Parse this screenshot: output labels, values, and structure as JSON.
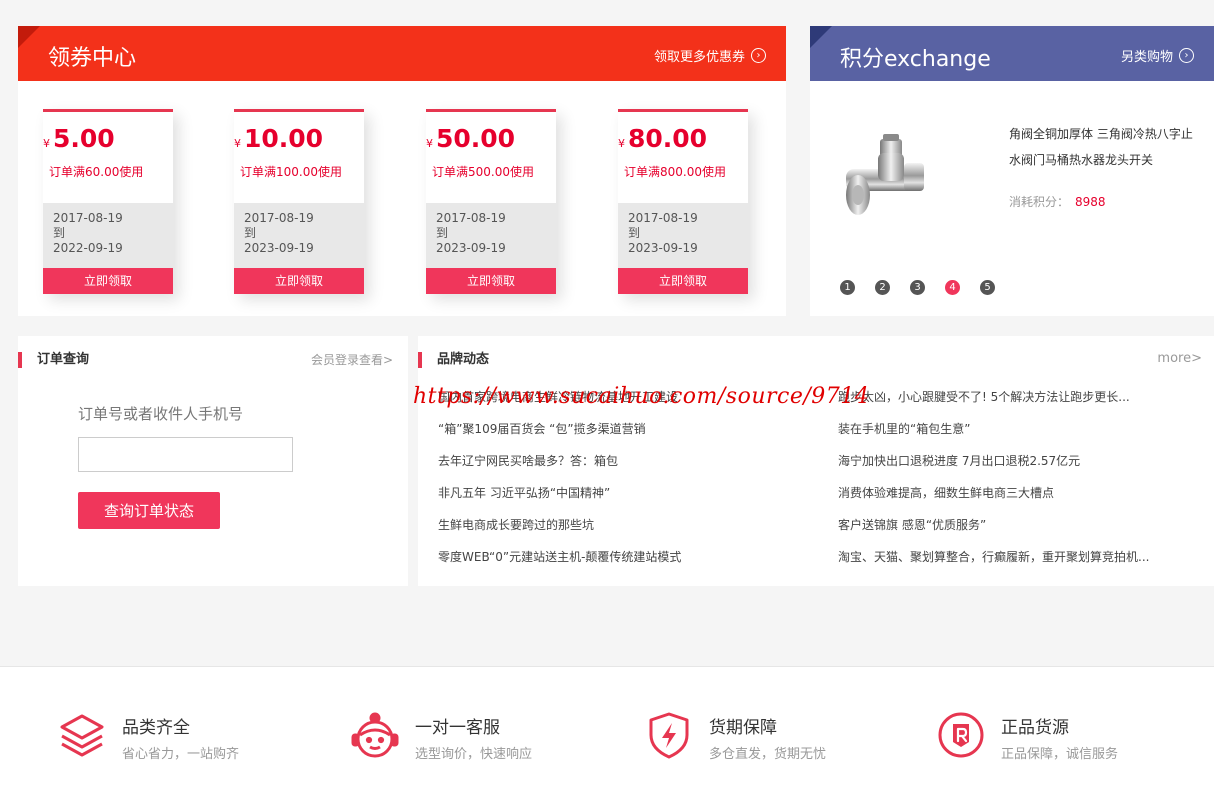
{
  "coupon_center": {
    "title": "领券中心",
    "more_link": "领取更多优惠券",
    "coupons": [
      {
        "currency": "¥",
        "amount": "5.00",
        "condition": "订单满60.00使用",
        "start": "2017-08-19",
        "to": "到",
        "end": "2022-09-19",
        "button": "立即领取"
      },
      {
        "currency": "¥",
        "amount": "10.00",
        "condition": "订单满100.00使用",
        "start": "2017-08-19",
        "to": "到",
        "end": "2023-09-19",
        "button": "立即领取"
      },
      {
        "currency": "¥",
        "amount": "50.00",
        "condition": "订单满500.00使用",
        "start": "2017-08-19",
        "to": "到",
        "end": "2023-09-19",
        "button": "立即领取"
      },
      {
        "currency": "¥",
        "amount": "80.00",
        "condition": "订单满800.00使用",
        "start": "2017-08-19",
        "to": "到",
        "end": "2023-09-19",
        "button": "立即领取"
      }
    ]
  },
  "exchange": {
    "title": "积分exchange",
    "more_link": "另类购物",
    "product_name": "角阀全铜加厚体 三角阀冷热八字止水阀门马桶热水器龙头开关",
    "points_label": "消耗积分：",
    "points_value": "8988",
    "pages": [
      "1",
      "2",
      "3",
      "4",
      "5"
    ],
    "active_page": "4"
  },
  "order_query": {
    "title": "订单查询",
    "login_link": "会员登录查看>",
    "label": "订单号或者收件人手机号",
    "input_value": "",
    "button": "查询订单状态"
  },
  "brand_news": {
    "title": "品牌动态",
    "more": "more>",
    "left_items": [
      "国内首家跨境电商生鲜冷链物流基地开工建设",
      "“箱”聚109届百货会 “包”揽多渠道营销",
      "去年辽宁网民买啥最多？答：箱包",
      "非凡五年 习近平弘扬“中国精神”",
      "生鲜电商成长要跨过的那些坑",
      "零度WEB“0”元建站送主机-颠覆传统建站模式"
    ],
    "right_items": [
      "跑步太凶，小心跟腱受不了! 5个解决方法让跑步更长...",
      "装在手机里的“箱包生意”",
      "海宁加快出口退税进度 7月出口退税2.57亿元",
      "消费体验难提高，细数生鲜电商三大槽点",
      "客户送锦旗 感恩“优质服务”",
      "淘宝、天猫、聚划算整合，行癫履新，重开聚划算竞拍机..."
    ]
  },
  "watermark": "https://www.sucaihuo.com/source/9714",
  "features": [
    {
      "icon": "layers-icon",
      "title": "品类齐全",
      "desc": "省心省力，一站购齐"
    },
    {
      "icon": "customer-service-icon",
      "title": "一对一客服",
      "desc": "选型询价，快速响应"
    },
    {
      "icon": "shield-lightning-icon",
      "title": "货期保障",
      "desc": "多仓直发，货期无忧"
    },
    {
      "icon": "registered-badge-icon",
      "title": "正品货源",
      "desc": "正品保障，诚信服务"
    }
  ],
  "colors": {
    "coupon_header": "#f3311a",
    "exchange_header": "#5962a3",
    "accent": "#f0365b",
    "price": "#e6002d"
  }
}
